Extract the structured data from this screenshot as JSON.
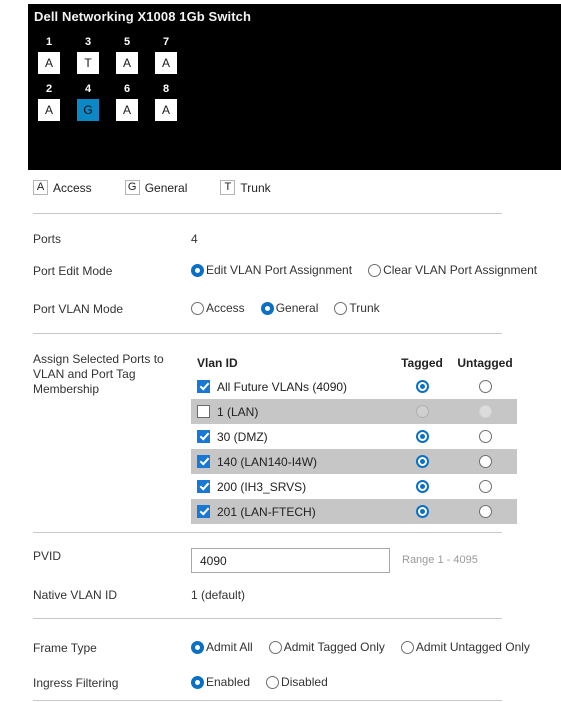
{
  "switch": {
    "title": "Dell Networking X1008 1Gb Switch",
    "ports": [
      {
        "number": "1",
        "mode": "A",
        "selected": false
      },
      {
        "number": "3",
        "mode": "T",
        "selected": false
      },
      {
        "number": "5",
        "mode": "A",
        "selected": false
      },
      {
        "number": "7",
        "mode": "A",
        "selected": false
      },
      {
        "number": "2",
        "mode": "A",
        "selected": false
      },
      {
        "number": "4",
        "mode": "G",
        "selected": true
      },
      {
        "number": "6",
        "mode": "A",
        "selected": false
      },
      {
        "number": "8",
        "mode": "A",
        "selected": false
      }
    ],
    "selected_color": "#0d88c7"
  },
  "legend": [
    {
      "key": "A",
      "label": "Access"
    },
    {
      "key": "G",
      "label": "General"
    },
    {
      "key": "T",
      "label": "Trunk"
    }
  ],
  "ports_row": {
    "label": "Ports",
    "value": "4"
  },
  "port_edit_mode": {
    "label": "Port Edit Mode",
    "options": [
      {
        "label": "Edit VLAN Port Assignment",
        "selected": true
      },
      {
        "label": "Clear VLAN Port Assignment",
        "selected": false
      }
    ]
  },
  "port_vlan_mode": {
    "label": "Port VLAN Mode",
    "options": [
      {
        "label": "Access",
        "selected": false
      },
      {
        "label": "General",
        "selected": true
      },
      {
        "label": "Trunk",
        "selected": false
      }
    ]
  },
  "assign": {
    "label": "Assign Selected Ports to VLAN and Port Tag Membership",
    "columns": {
      "vlan_id": "Vlan ID",
      "tagged": "Tagged",
      "untagged": "Untagged"
    },
    "rows": [
      {
        "name": "All Future VLANs (4090)",
        "checked": true,
        "tagged": true,
        "untagged": false,
        "disabled": false
      },
      {
        "name": "1 (LAN)",
        "checked": false,
        "tagged": false,
        "untagged": false,
        "disabled": true
      },
      {
        "name": "30 (DMZ)",
        "checked": true,
        "tagged": true,
        "untagged": false,
        "disabled": false
      },
      {
        "name": "140 (LAN140-I4W)",
        "checked": true,
        "tagged": true,
        "untagged": false,
        "disabled": false
      },
      {
        "name": "200 (IH3_SRVS)",
        "checked": true,
        "tagged": true,
        "untagged": false,
        "disabled": false
      },
      {
        "name": "201 (LAN-FTECH)",
        "checked": true,
        "tagged": true,
        "untagged": false,
        "disabled": false
      }
    ]
  },
  "pvid": {
    "label": "PVID",
    "value": "4090",
    "placeholder": "",
    "hint": "Range 1 - 4095"
  },
  "native_vlan": {
    "label": "Native VLAN ID",
    "value": "1 (default)"
  },
  "frame_type": {
    "label": "Frame Type",
    "options": [
      {
        "label": "Admit All",
        "selected": true
      },
      {
        "label": "Admit Tagged Only",
        "selected": false
      },
      {
        "label": "Admit Untagged Only",
        "selected": false
      }
    ]
  },
  "ingress_filtering": {
    "label": "Ingress Filtering",
    "options": [
      {
        "label": "Enabled",
        "selected": true
      },
      {
        "label": "Disabled",
        "selected": false
      }
    ]
  },
  "colors": {
    "accent_blue": "#0b70c4",
    "checkbox_blue": "#1878d4",
    "port_selected": "#0d88c7",
    "row_alt": "#c6c6c6",
    "panel_bg": "#000000"
  }
}
